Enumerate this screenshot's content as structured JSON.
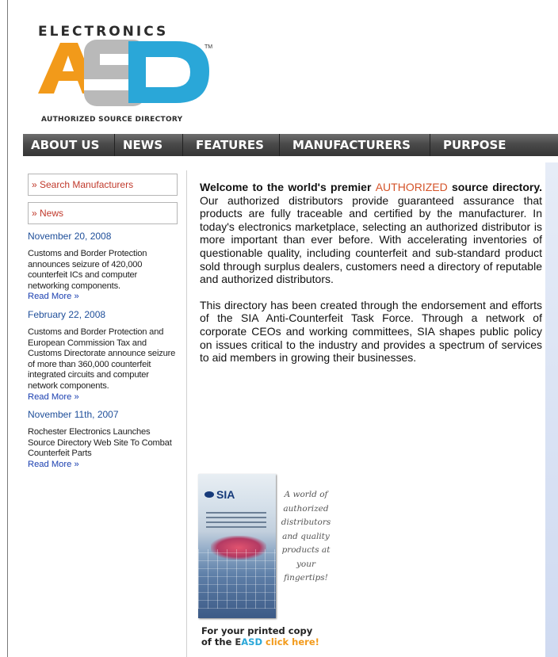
{
  "logo": {
    "top_text": "ELECTRONICS",
    "tm": "TM",
    "letters": "ASD",
    "tagline": "AUTHORIZED SOURCE DIRECTORY"
  },
  "nav": {
    "items": [
      "ABOUT US",
      "NEWS",
      "FEATURES",
      "MANUFACTURERS",
      "PURPOSE"
    ]
  },
  "sidebar": {
    "search_label": "» Search Manufacturers",
    "news_label": "» News",
    "news": [
      {
        "date": "November 20, 2008",
        "text": "Customs and Border Protection announces seizure of 420,000 counterfeit ICs and computer networking components.",
        "link": "Read More »"
      },
      {
        "date": "February 22, 2008",
        "text": "Customs and Border Protection and European Commission Tax and Customs Directorate announce seizure of more than 360,000 counterfeit integrated circuits and computer network components.",
        "link": "Read More »"
      },
      {
        "date": "November 11th, 2007",
        "text": "Rochester Electronics Launches Source Directory Web Site To Combat Counterfeit Parts",
        "link": "Read More »"
      }
    ]
  },
  "main": {
    "welcome_bold_1": "Welcome to the world's premier ",
    "welcome_highlight": "AUTHORIZED",
    "welcome_bold_2": " source directory.",
    "paragraph_1_rest": " Our authorized distributors provide guaranteed assurance that products are fully traceable and certified by the manufacturer. In today's electronics marketplace, selecting an authorized distributor is more important than ever before. With accelerating inventories of questionable quality, including counterfeit and sub-standard product sold through surplus dealers, customers need a directory of reputable and authorized distributors.",
    "paragraph_2": "This directory has been created through the endorsement and efforts of the SIA Anti-Counterfeit Task Force. Through a network of corporate CEOs and working committees, SIA shapes public policy on issues critical to the industry and provides a spectrum of services to aid members in growing their businesses."
  },
  "promo": {
    "book_brand": "SIA",
    "tagline": "A world of authorized distributors and quality products at your fingertips!",
    "order_line_1": "For your printed copy",
    "order_prefix": "of the ",
    "order_brand_e": "E",
    "order_brand_asd": "ASD",
    "order_link": "click here!"
  },
  "colors": {
    "accent_orange": "#d4542a",
    "link_blue": "#1a3fb0",
    "date_blue": "#1f4f9a",
    "nav_dark": "#4a4a4a",
    "logo_orange": "#f29a1a",
    "logo_blue": "#2aa7d8"
  }
}
